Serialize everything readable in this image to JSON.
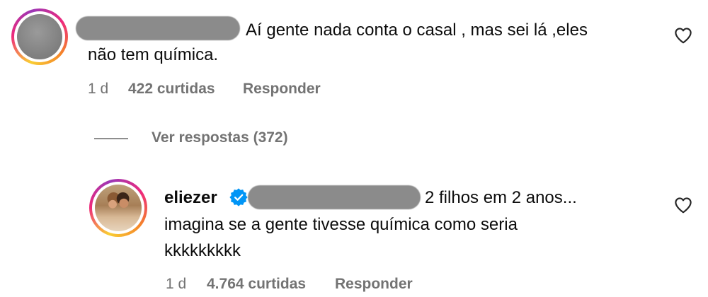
{
  "comments": [
    {
      "username_hidden": true,
      "text_line1": "Aí gente nada conta o casal , mas sei lá ,eles",
      "text_line2": "não tem química.",
      "time": "1 d",
      "likes": "422 curtidas",
      "reply_label": "Responder",
      "like_icon": "heart-outline-icon"
    },
    {
      "username": "eliezer",
      "verified": true,
      "text_line1": "2 filhos em 2 anos...",
      "text_line2": "imagina se a gente tivesse química como seria",
      "text_line3": "kkkkkkkkk",
      "time": "1 d",
      "likes": "4.764 curtidas",
      "reply_label": "Responder",
      "like_icon": "heart-outline-icon"
    }
  ],
  "view_replies_label": "Ver respostas (372)",
  "colors": {
    "meta_text": "#737373",
    "verified_badge": "#0095f6",
    "blur_bar": "#8b8b8b",
    "ring_start": "#f9ce34",
    "ring_mid": "#ee2a7b",
    "ring_end": "#9b36b7"
  }
}
